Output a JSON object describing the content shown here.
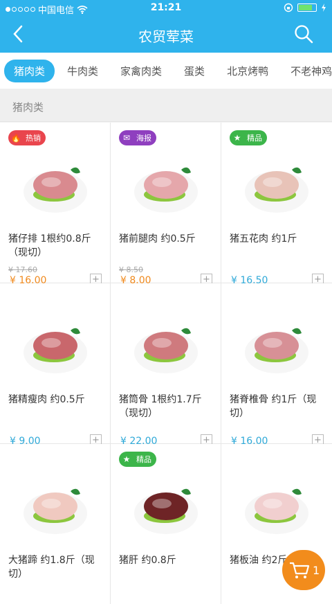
{
  "status": {
    "carrier": "中国电信",
    "time": "21:21"
  },
  "header": {
    "title": "农贸荤菜"
  },
  "tabs": [
    "猪肉类",
    "牛肉类",
    "家禽肉类",
    "蛋类",
    "北京烤鸭",
    "不老神鸡"
  ],
  "section": {
    "title": "猪肉类"
  },
  "products": [
    {
      "name": "猪仔排 1根约0.8斤（现切）",
      "orig": "¥ 17.60",
      "price": "¥ 16.00",
      "price_color": "#f08a1e",
      "badge": "热销",
      "badge_type": "hot",
      "image": "pork-ribs"
    },
    {
      "name": "猪前腿肉 约0.5斤",
      "orig": "¥ 8.50",
      "price": "¥ 8.00",
      "price_color": "#f08a1e",
      "badge": "海报",
      "badge_type": "poster",
      "image": "pork-foreleg"
    },
    {
      "name": "猪五花肉 约1斤",
      "orig": "",
      "price": "¥ 16.50",
      "price_color": "#2fa9d8",
      "badge": "精品",
      "badge_type": "pick",
      "image": "pork-belly"
    },
    {
      "name": "猪精瘦肉 约0.5斤",
      "orig": "",
      "price": "¥ 9.00",
      "price_color": "#2fa9d8",
      "badge": "",
      "badge_type": "",
      "image": "lean-pork"
    },
    {
      "name": "猪筒骨 1根约1.7斤（现切）",
      "orig": "",
      "price": "¥ 22.00",
      "price_color": "#2fa9d8",
      "badge": "",
      "badge_type": "",
      "image": "pork-bone"
    },
    {
      "name": "猪脊椎骨 约1斤（现切）",
      "orig": "",
      "price": "¥ 16.00",
      "price_color": "#2fa9d8",
      "badge": "",
      "badge_type": "",
      "image": "pork-spine"
    },
    {
      "name": "大猪蹄 约1.8斤（现切）",
      "orig": "",
      "price": "",
      "price_color": "",
      "badge": "",
      "badge_type": "",
      "image": "pig-trotter"
    },
    {
      "name": "猪肝 约0.8斤",
      "orig": "",
      "price": "",
      "price_color": "",
      "badge": "精品",
      "badge_type": "pick",
      "image": "pork-liver"
    },
    {
      "name": "猪板油 约2斤",
      "orig": "",
      "price": "",
      "price_color": "",
      "badge": "",
      "badge_type": "",
      "image": "pork-fat"
    }
  ],
  "cart": {
    "count": "1"
  },
  "icons": {
    "back": "back-icon",
    "search": "search-icon",
    "cart": "cart-icon",
    "add": "plus-icon"
  }
}
